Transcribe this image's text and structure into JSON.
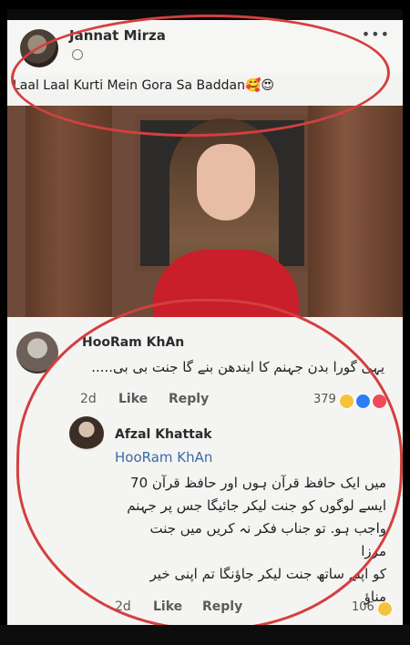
{
  "post": {
    "author": "Jannat Mirza",
    "time_prefix": "",
    "caption": "Laal Laal Kurti Mein Gora Sa Baddan🥰😍",
    "more": "•••"
  },
  "comments": [
    {
      "author": "HooRam KhAn",
      "text": "یہی گورا بدن جہنم کا ایندھن بنے گا جنت بی بی.....",
      "time": "2d",
      "like": "Like",
      "reply": "Reply",
      "reactions_count": "379"
    }
  ],
  "reply": {
    "author": "Afzal Khattak",
    "mention": "HooRam KhAn",
    "lines": [
      "میں ایک حافظ قرآن ہوں اور حافظ قرآن 70",
      "ایسے لوگوں کو جنت لیکر جائیگا جس پر جہنم",
      "واجب ہو. تو جناب فکر نہ کریں میں جنت مرزا",
      "کو اپنے ساتھ جنت لیکر جاؤنگا تم اپنی خیر",
      "مناؤ"
    ],
    "time": "2d",
    "like": "Like",
    "reply": "Reply",
    "reactions_count": "106"
  },
  "colors": {
    "annotation": "#d43f3f",
    "mention": "#3b6aa8"
  }
}
